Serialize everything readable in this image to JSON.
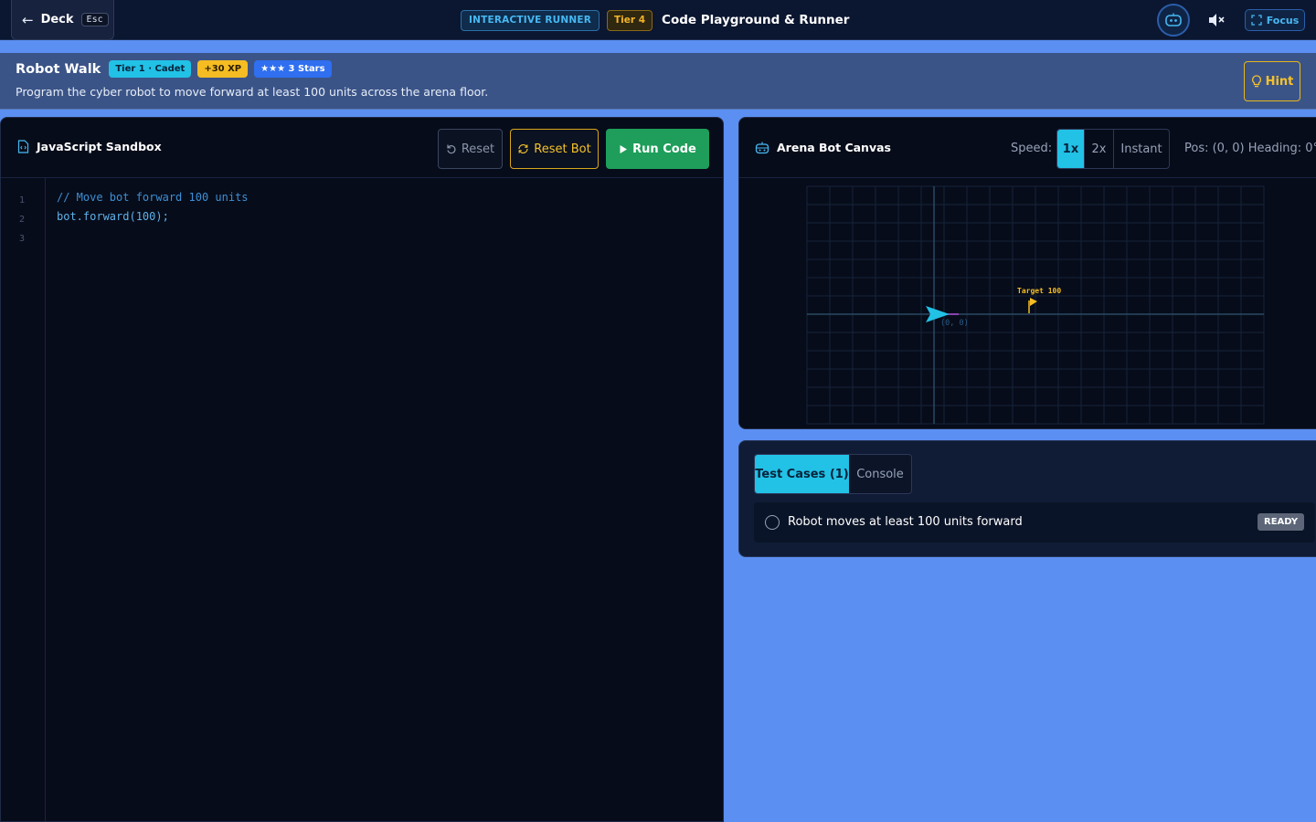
{
  "topbar": {
    "deck_label": "Deck",
    "deck_kbd": "Esc",
    "runner_pill": "INTERACTIVE RUNNER",
    "tier_pill": "Tier 4",
    "title": "Code Playground & Runner",
    "focus_label": "Focus"
  },
  "lesson": {
    "title": "Robot Walk",
    "tier_badge": "Tier 1 · Cadet",
    "xp_badge": "+30 XP",
    "stars_badge": "★★★ 3 Stars",
    "description": "Program the cyber robot to move forward at least 100 units across the arena floor.",
    "hint_label": "Hint"
  },
  "editor": {
    "title": "JavaScript Sandbox",
    "reset_label": "Reset",
    "reset_bot_label": "Reset Bot",
    "run_label": "Run Code",
    "line_numbers": [
      "1",
      "2",
      "3"
    ],
    "lines": [
      "// Move bot forward 100 units",
      "bot.forward(100);",
      ""
    ]
  },
  "arena": {
    "title": "Arena Bot Canvas",
    "speed_label": "Speed:",
    "speed_options": [
      "1x",
      "2x",
      "Instant"
    ],
    "speed_selected": "1x",
    "position_readout": "Pos: (0, 0)  Heading: 0°",
    "origin_label": "(0, 0)",
    "target_label": "Target 100"
  },
  "tests": {
    "tab_tests": "Test Cases (1)",
    "tab_console": "Console",
    "items": [
      {
        "name": "Robot moves at least 100 units forward",
        "status": "READY"
      }
    ]
  },
  "colors": {
    "accent_cyan": "#22c1e6",
    "accent_yellow": "#f5bd23",
    "run_green": "#1e9e5a",
    "page_blue": "#5b8ff2"
  }
}
